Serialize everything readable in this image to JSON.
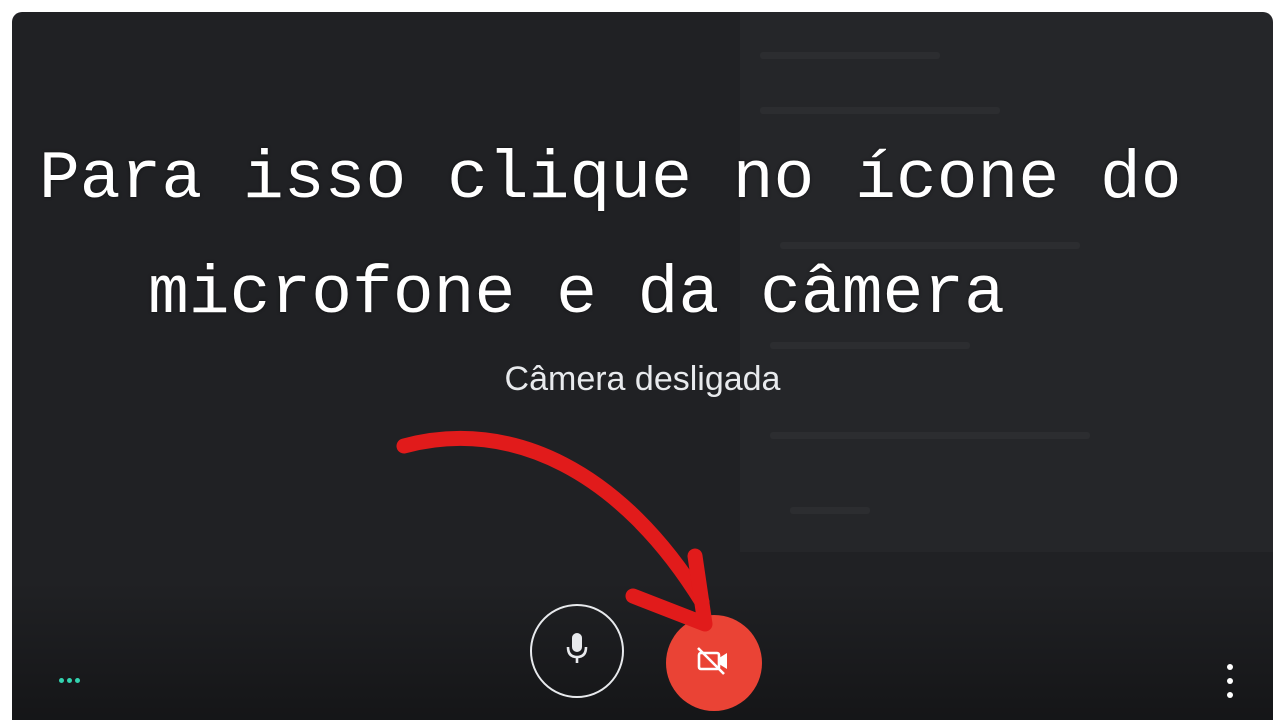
{
  "overlay": {
    "line1": "Para isso clique no ícone do",
    "line2": "microfone e da câmera"
  },
  "preview": {
    "status_text": "Câmera desligada"
  },
  "controls": {
    "microphone_icon": "microphone-icon",
    "camera_off_icon": "video-camera-off-icon",
    "camera_button_color": "#ea4335",
    "more_options_left_icon": "horizontal-dots-icon",
    "more_options_right_icon": "vertical-dots-icon",
    "left_dots_color": "#34d3b0"
  },
  "annotation": {
    "arrow_color": "#e11b1b",
    "arrow_icon": "curved-red-arrow"
  }
}
